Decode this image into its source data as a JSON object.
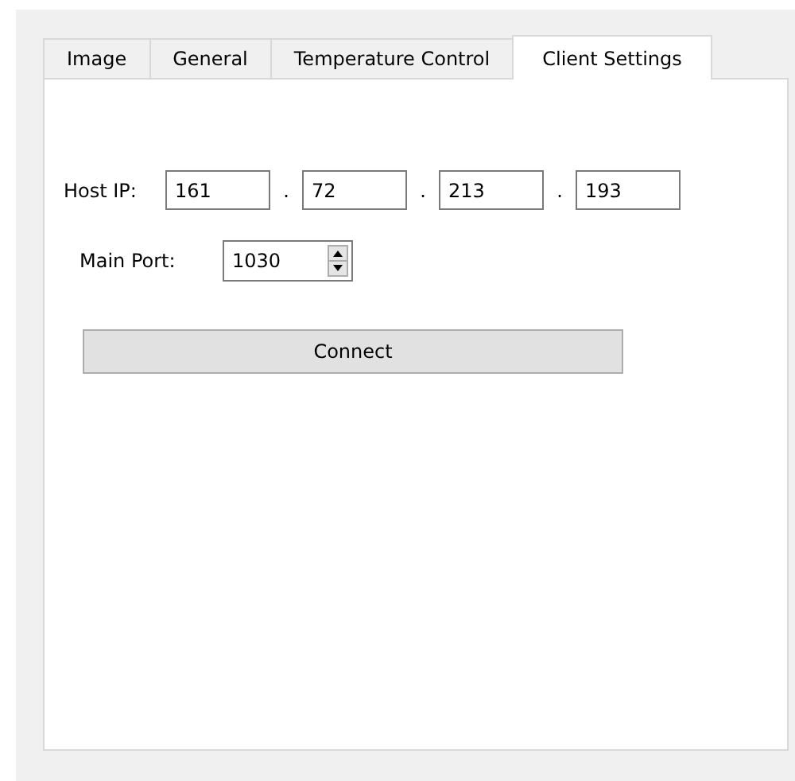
{
  "tabs": [
    {
      "label": "Image",
      "selected": false
    },
    {
      "label": "General",
      "selected": false
    },
    {
      "label": "Temperature Control",
      "selected": false
    },
    {
      "label": "Client Settings",
      "selected": true
    }
  ],
  "host_ip": {
    "label": "Host IP:",
    "separator": ".",
    "octets": [
      "161",
      "72",
      "213",
      "193"
    ]
  },
  "main_port": {
    "label": "Main Port:",
    "value": "1030"
  },
  "connect_button": {
    "label": "Connect"
  }
}
